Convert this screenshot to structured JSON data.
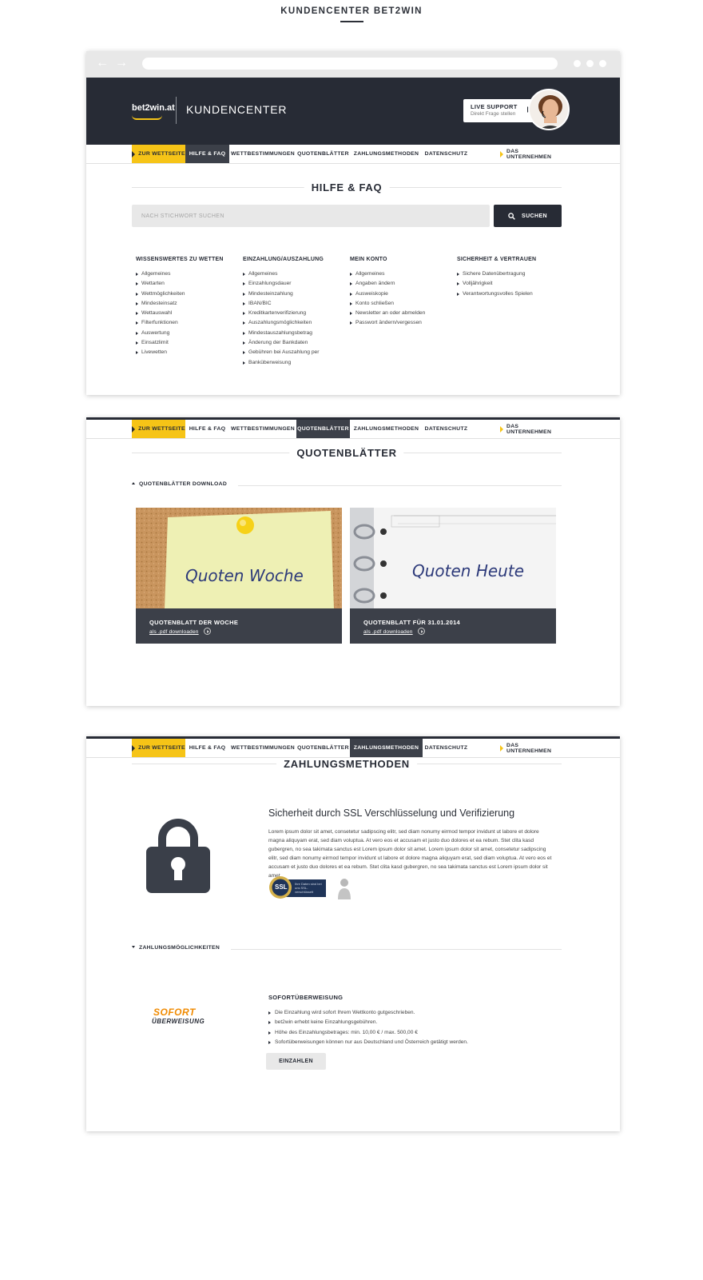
{
  "page": {
    "title": "KUNDENCENTER BET2WIN"
  },
  "header": {
    "logo": "bet2win.at",
    "title": "KUNDENCENTER",
    "support_title": "LIVE SUPPORT",
    "support_sub": "Direkt Frage stellen"
  },
  "nav": {
    "zur_wettseite": "ZUR WETTSEITE",
    "hilfe": "HILFE & FAQ",
    "wettbestimmungen": "WETTBESTIMMUNGEN",
    "quotenblaetter": "QUOTENBLÄTTER",
    "zahlungsmethoden": "ZAHLUNGSMETHODEN",
    "datenschutz": "DATENSCHUTZ",
    "unternehmen": "DAS UNTERNEHMEN"
  },
  "faq": {
    "heading": "HILFE & FAQ",
    "search_placeholder": "NACH STICHWORT SUCHEN",
    "search_button": "SUCHEN",
    "columns": [
      {
        "title": "WISSENSWERTES ZU WETTEN",
        "items": [
          "Allgemeines",
          "Wettarten",
          "Wettmöglichkeiten",
          "Mindesteinsatz",
          "Wettauswahl",
          "Filterfunktionen",
          "Auswertung",
          "Einsatzlimit",
          "Livewetten"
        ]
      },
      {
        "title": "EINZAHLUNG/AUSZAHLUNG",
        "items": [
          "Allgemeines",
          "Einzahlungsdauer",
          "Mindesteinzahlung",
          "IBAN/BIC",
          "Kreditkartenverifizierung",
          "Auszahlungsmöglichkeiten",
          "Mindestauszahlungsbetrag",
          "Änderung der Bankdaten",
          "Gebühren bei Auszahlung per",
          "Banküberweisung"
        ]
      },
      {
        "title": "MEIN KONTO",
        "items": [
          "Allgemeines",
          "Angaben ändern",
          "Ausweiskopie",
          "Konto schließen",
          "Newsletter an oder abmelden",
          "Passwort ändern/vergessen"
        ]
      },
      {
        "title": "SICHERHEIT & VERTRAUEN",
        "items": [
          "Sichere Datenübertragung",
          "Volljährigkeit",
          "Verantwortungsvolles Spielen"
        ]
      }
    ]
  },
  "quoten": {
    "heading": "QUOTENBLÄTTER",
    "subheading": "QUOTENBLÄTTER DOWNLOAD",
    "cards": [
      {
        "image_text": "Quoten Woche",
        "title": "QUOTENBLATT DER WOCHE",
        "link": "als .pdf downloaden"
      },
      {
        "image_text": "Quoten Heute",
        "title": "QUOTENBLATT FÜR 31.01.2014",
        "link": "als .pdf downloaden"
      }
    ]
  },
  "zahlung": {
    "heading": "ZAHLUNGSMETHODEN",
    "ssl_heading": "Sicherheit durch SSL Verschlüsselung und Verifizierung",
    "ssl_text": "Lorem ipsum dolor sit amet, consetetur sadipscing elitr, sed diam nonumy eirmod tempor invidunt ut labore et dolore magna aliquyam erat, sed diam voluptua. At vero eos et accusam et justo duo dolores et ea rebum. Stet clita kasd gubergren, no sea takimata sanctus est Lorem ipsum dolor sit amet. Lorem ipsum dolor sit amet, consetetur sadipscing elitr, sed diam nonumy eirmod tempor invidunt ut labore et dolore magna aliquyam erat, sed diam voluptua. At vero eos et accusam et justo duo dolores et ea rebum. Stet clita kasd gubergren, no sea takimata sanctus est Lorem ipsum dolor sit amet.",
    "ssl_badge": "SSL",
    "ssl_badge_text": "Ihre Daten sind bei uns SSL-verschlüsselt",
    "sub": "ZAHLUNGSMÖGLICHKEITEN",
    "sofort_logo_top": "SOFORT",
    "sofort_logo_bottom": "ÜBERWEISUNG",
    "sofort_heading": "SOFORTÜBERWEISUNG",
    "sofort_items": [
      "Die Einzahlung wird sofort Ihrem Wettkonto gutgeschrieben.",
      "bet2win erhebt keine Einzahlungsgebühren.",
      "Höhe des Einzahlungsbetrages: min. 10,00 € / max. 500,00 €",
      "Sofortüberweisungen können nur aus Deutschland und Österreich getätigt werden."
    ],
    "button": "EINZAHLEN"
  },
  "colors": {
    "dark": "#272b35",
    "accent": "#f6c417",
    "nav_active": "#3c4049",
    "sofort": "#f08a00"
  }
}
